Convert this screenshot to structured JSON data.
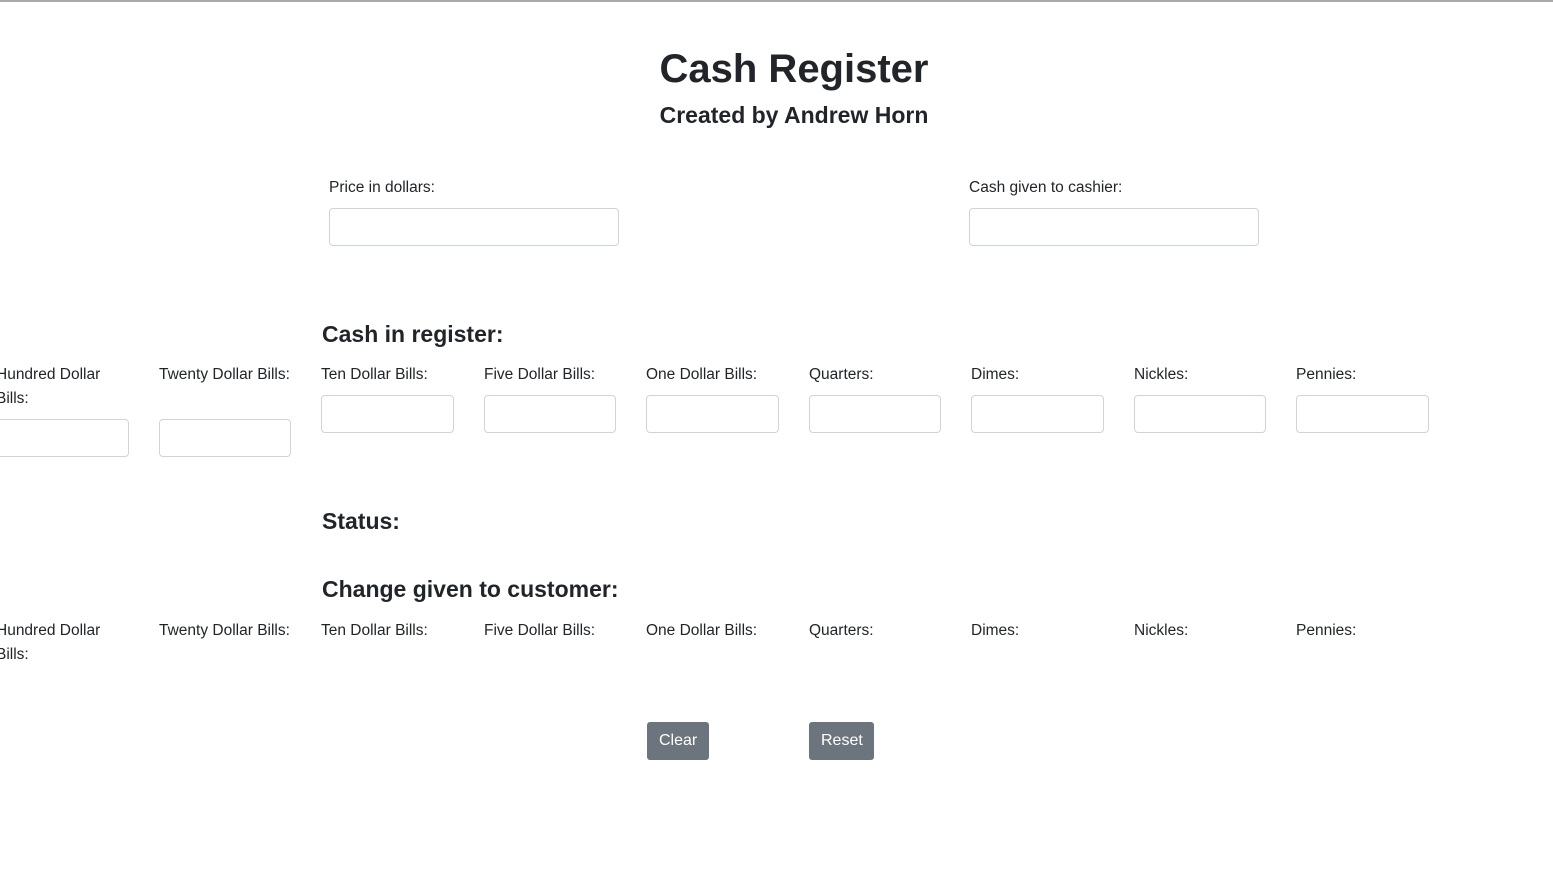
{
  "header": {
    "title": "Cash Register",
    "subtitle": "Created by Andrew Horn"
  },
  "transaction": {
    "price_label": "Price in dollars:",
    "price_value": "",
    "cash_label": "Cash given to cashier:",
    "cash_value": ""
  },
  "register": {
    "heading": "Cash in register:",
    "hundred": "Hundred Dollar Bills:",
    "twenty": "Twenty Dollar Bills:",
    "ten": "Ten Dollar Bills:",
    "five": "Five Dollar Bills:",
    "one": "One Dollar Bills:",
    "quarters": "Quarters:",
    "dimes": "Dimes:",
    "nickels": "Nickles:",
    "pennies": "Pennies:"
  },
  "status": {
    "heading": "Status:"
  },
  "change": {
    "heading": "Change given to customer:",
    "hundred": "Hundred Dollar Bills:",
    "twenty": "Twenty Dollar Bills:",
    "ten": "Ten Dollar Bills:",
    "five": "Five Dollar Bills:",
    "one": "One Dollar Bills:",
    "quarters": "Quarters:",
    "dimes": "Dimes:",
    "nickels": "Nickles:",
    "pennies": "Pennies:"
  },
  "buttons": {
    "clear": "Clear",
    "reset": "Reset"
  },
  "colors": {
    "button_bg": "#6c757d",
    "text": "#212529",
    "input_border": "#ced4da"
  }
}
